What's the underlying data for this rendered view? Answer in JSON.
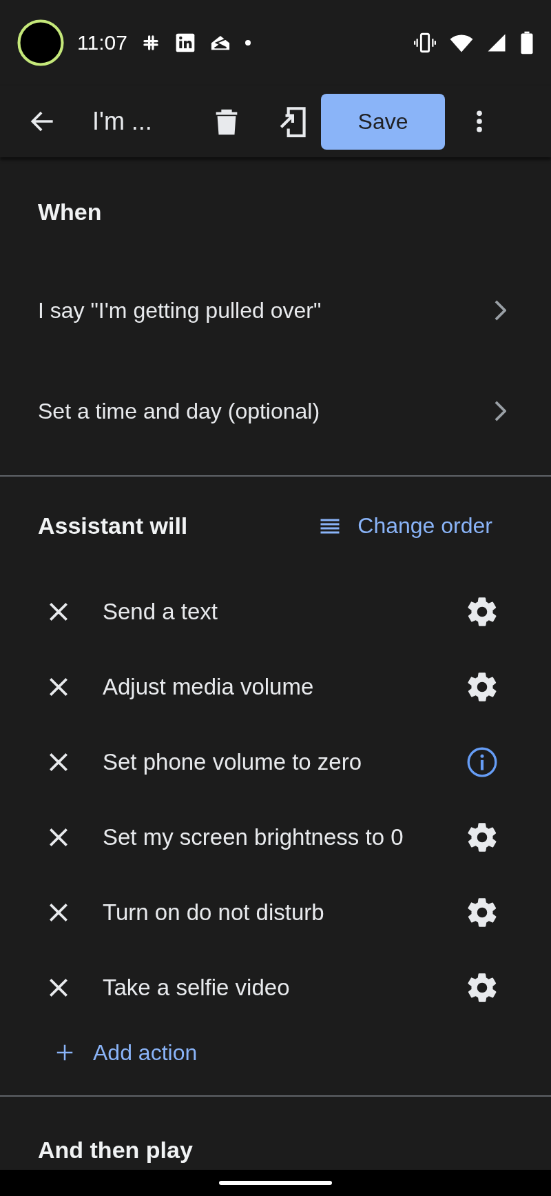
{
  "status_bar": {
    "time": "11:07"
  },
  "toolbar": {
    "title": "I'm ...",
    "save": "Save"
  },
  "when": {
    "heading": "When",
    "rows": [
      {
        "label": "I say \"I'm getting pulled over\""
      },
      {
        "label": "Set a time and day (optional)"
      }
    ]
  },
  "assistant": {
    "heading": "Assistant will",
    "change_order": "Change order",
    "actions": [
      {
        "label": "Send a text",
        "kind": "settings"
      },
      {
        "label": "Adjust media volume",
        "kind": "settings"
      },
      {
        "label": "Set phone volume to zero",
        "kind": "info"
      },
      {
        "label": "Set my screen brightness to 0",
        "kind": "settings"
      },
      {
        "label": "Turn on do not disturb",
        "kind": "settings"
      },
      {
        "label": "Take a selfie video",
        "kind": "settings"
      }
    ],
    "add_action": "Add action"
  },
  "then_play": {
    "heading": "And then play"
  }
}
